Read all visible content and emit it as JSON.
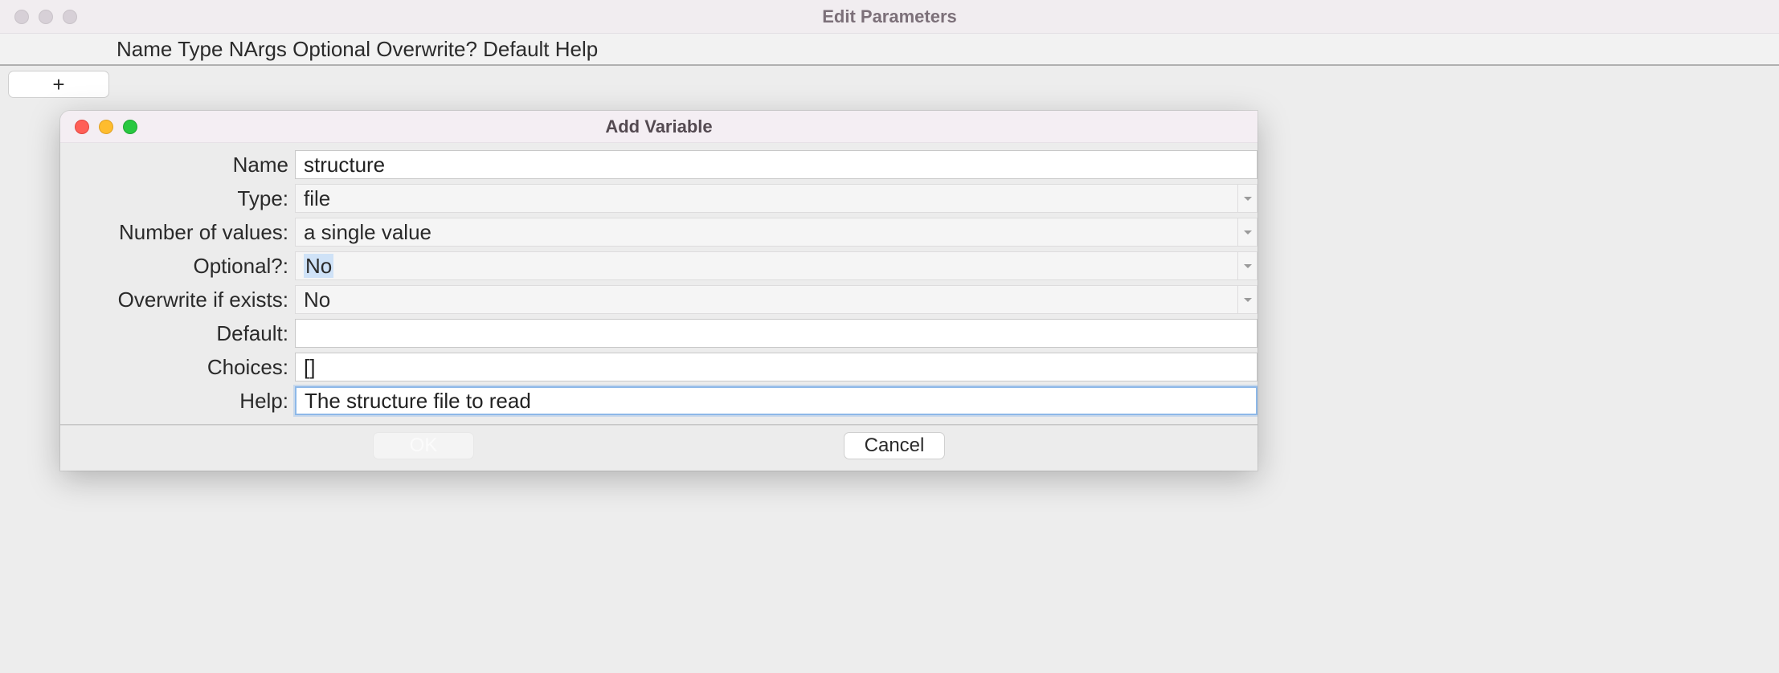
{
  "parent": {
    "title": "Edit Parameters",
    "columns": "Name Type NArgs Optional Overwrite? Default Help",
    "plus_label": "+"
  },
  "modal": {
    "title": "Add Variable",
    "labels": {
      "name": "Name",
      "type": "Type:",
      "nvalues": "Number of values:",
      "optional": "Optional?:",
      "overwrite": "Overwrite if exists:",
      "default": "Default:",
      "choices": "Choices:",
      "help": "Help:"
    },
    "values": {
      "name": "structure",
      "type": "file",
      "nvalues": "a single value",
      "optional": "No",
      "overwrite": "No",
      "default": "",
      "choices": "[]",
      "help": "The structure file to read"
    },
    "buttons": {
      "ok": "OK",
      "cancel": "Cancel"
    }
  }
}
